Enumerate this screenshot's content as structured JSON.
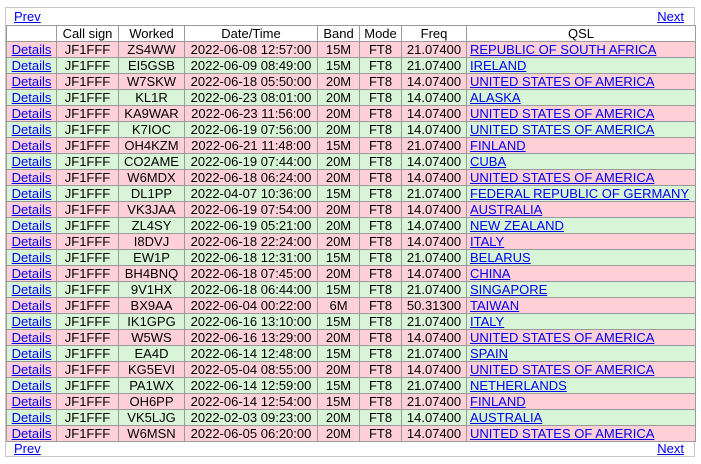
{
  "nav": {
    "prev_label": "Prev",
    "next_label": "Next"
  },
  "columns": [
    "",
    "Call sign",
    "Worked",
    "Date/Time",
    "Band",
    "Mode",
    "Freq",
    "QSL"
  ],
  "details_label": "Details",
  "colors": {
    "pink_row": "#ffd0d8",
    "green_row": "#d8f5d8",
    "link": "#0000ee"
  },
  "rows": [
    {
      "call": "JF1FFF",
      "worked": "ZS4WW",
      "datetime": "2022-06-08 12:57:00",
      "band": "15M",
      "mode": "FT8",
      "freq": "21.07400",
      "qsl": "REPUBLIC OF SOUTH AFRICA",
      "color": "pink"
    },
    {
      "call": "JF1FFF",
      "worked": "EI5GSB",
      "datetime": "2022-06-09 08:49:00",
      "band": "15M",
      "mode": "FT8",
      "freq": "21.07400",
      "qsl": "IRELAND",
      "color": "green"
    },
    {
      "call": "JF1FFF",
      "worked": "W7SKW",
      "datetime": "2022-06-18 05:50:00",
      "band": "20M",
      "mode": "FT8",
      "freq": "14.07400",
      "qsl": "UNITED STATES OF AMERICA",
      "color": "pink"
    },
    {
      "call": "JF1FFF",
      "worked": "KL1R",
      "datetime": "2022-06-23 08:01:00",
      "band": "20M",
      "mode": "FT8",
      "freq": "14.07400",
      "qsl": "ALASKA",
      "color": "green"
    },
    {
      "call": "JF1FFF",
      "worked": "KA9WAR",
      "datetime": "2022-06-23 11:56:00",
      "band": "20M",
      "mode": "FT8",
      "freq": "14.07400",
      "qsl": "UNITED STATES OF AMERICA",
      "color": "pink"
    },
    {
      "call": "JF1FFF",
      "worked": "K7IOC",
      "datetime": "2022-06-19 07:56:00",
      "band": "20M",
      "mode": "FT8",
      "freq": "14.07400",
      "qsl": "UNITED STATES OF AMERICA",
      "color": "green"
    },
    {
      "call": "JF1FFF",
      "worked": "OH4KZM",
      "datetime": "2022-06-21 11:48:00",
      "band": "15M",
      "mode": "FT8",
      "freq": "21.07400",
      "qsl": "FINLAND",
      "color": "pink"
    },
    {
      "call": "JF1FFF",
      "worked": "CO2AME",
      "datetime": "2022-06-19 07:44:00",
      "band": "20M",
      "mode": "FT8",
      "freq": "14.07400",
      "qsl": "CUBA",
      "color": "green"
    },
    {
      "call": "JF1FFF",
      "worked": "W6MDX",
      "datetime": "2022-06-18 06:24:00",
      "band": "20M",
      "mode": "FT8",
      "freq": "14.07400",
      "qsl": "UNITED STATES OF AMERICA",
      "color": "pink"
    },
    {
      "call": "JF1FFF",
      "worked": "DL1PP",
      "datetime": "2022-04-07 10:36:00",
      "band": "15M",
      "mode": "FT8",
      "freq": "21.07400",
      "qsl": "FEDERAL REPUBLIC OF GERMANY",
      "color": "green"
    },
    {
      "call": "JF1FFF",
      "worked": "VK3JAA",
      "datetime": "2022-06-19 07:54:00",
      "band": "20M",
      "mode": "FT8",
      "freq": "14.07400",
      "qsl": "AUSTRALIA",
      "color": "pink"
    },
    {
      "call": "JF1FFF",
      "worked": "ZL4SY",
      "datetime": "2022-06-19 05:21:00",
      "band": "20M",
      "mode": "FT8",
      "freq": "14.07400",
      "qsl": "NEW ZEALAND",
      "color": "green"
    },
    {
      "call": "JF1FFF",
      "worked": "I8DVJ",
      "datetime": "2022-06-18 22:24:00",
      "band": "20M",
      "mode": "FT8",
      "freq": "14.07400",
      "qsl": "ITALY",
      "color": "pink"
    },
    {
      "call": "JF1FFF",
      "worked": "EW1P",
      "datetime": "2022-06-18 12:31:00",
      "band": "15M",
      "mode": "FT8",
      "freq": "21.07400",
      "qsl": "BELARUS",
      "color": "green"
    },
    {
      "call": "JF1FFF",
      "worked": "BH4BNQ",
      "datetime": "2022-06-18 07:45:00",
      "band": "20M",
      "mode": "FT8",
      "freq": "14.07400",
      "qsl": "CHINA",
      "color": "pink"
    },
    {
      "call": "JF1FFF",
      "worked": "9V1HX",
      "datetime": "2022-06-18 06:44:00",
      "band": "15M",
      "mode": "FT8",
      "freq": "21.07400",
      "qsl": "SINGAPORE",
      "color": "green"
    },
    {
      "call": "JF1FFF",
      "worked": "BX9AA",
      "datetime": "2022-06-04 00:22:00",
      "band": "6M",
      "mode": "FT8",
      "freq": "50.31300",
      "qsl": "TAIWAN",
      "color": "pink"
    },
    {
      "call": "JF1FFF",
      "worked": "IK1GPG",
      "datetime": "2022-06-16 13:10:00",
      "band": "15M",
      "mode": "FT8",
      "freq": "21.07400",
      "qsl": "ITALY",
      "color": "green"
    },
    {
      "call": "JF1FFF",
      "worked": "W5WS",
      "datetime": "2022-06-16 13:29:00",
      "band": "20M",
      "mode": "FT8",
      "freq": "14.07400",
      "qsl": "UNITED STATES OF AMERICA",
      "color": "pink"
    },
    {
      "call": "JF1FFF",
      "worked": "EA4D",
      "datetime": "2022-06-14 12:48:00",
      "band": "15M",
      "mode": "FT8",
      "freq": "21.07400",
      "qsl": "SPAIN",
      "color": "green"
    },
    {
      "call": "JF1FFF",
      "worked": "KG5EVI",
      "datetime": "2022-05-04 08:55:00",
      "band": "20M",
      "mode": "FT8",
      "freq": "14.07400",
      "qsl": "UNITED STATES OF AMERICA",
      "color": "pink"
    },
    {
      "call": "JF1FFF",
      "worked": "PA1WX",
      "datetime": "2022-06-14 12:59:00",
      "band": "15M",
      "mode": "FT8",
      "freq": "21.07400",
      "qsl": "NETHERLANDS",
      "color": "green"
    },
    {
      "call": "JF1FFF",
      "worked": "OH6PP",
      "datetime": "2022-06-14 12:54:00",
      "band": "15M",
      "mode": "FT8",
      "freq": "21.07400",
      "qsl": "FINLAND",
      "color": "pink"
    },
    {
      "call": "JF1FFF",
      "worked": "VK5LJG",
      "datetime": "2022-02-03 09:23:00",
      "band": "20M",
      "mode": "FT8",
      "freq": "14.07400",
      "qsl": "AUSTRALIA",
      "color": "green"
    },
    {
      "call": "JF1FFF",
      "worked": "W6MSN",
      "datetime": "2022-06-05 06:20:00",
      "band": "20M",
      "mode": "FT8",
      "freq": "14.07400",
      "qsl": "UNITED STATES OF AMERICA",
      "color": "pink"
    }
  ]
}
